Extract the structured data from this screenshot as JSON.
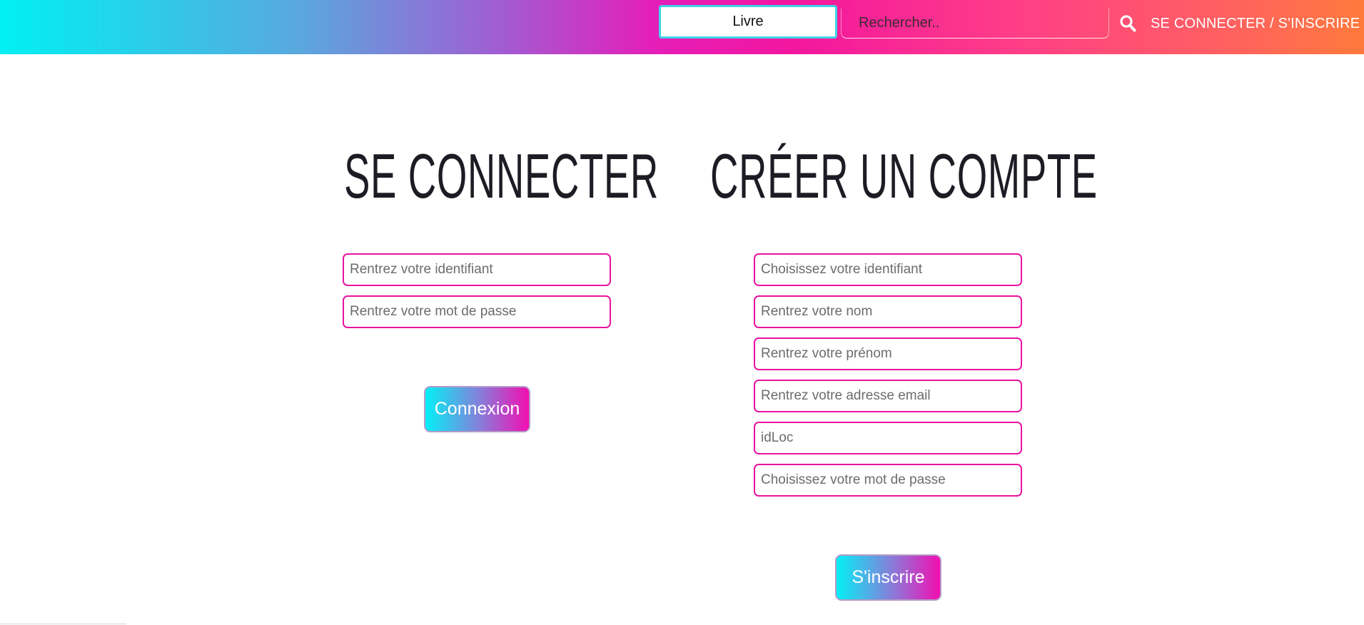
{
  "header": {
    "category": "Livre",
    "search_placeholder": "Rechercher..",
    "search_icon": "search-icon",
    "login_link": "SE CONNECTER / S'INSCRIRE"
  },
  "login": {
    "title": "SE CONNECTER",
    "fields": [
      "Rentrez votre identifiant",
      "Rentrez votre mot de passe"
    ],
    "submit": "Connexion"
  },
  "register": {
    "title": "CRÉER UN COMPTE",
    "fields": [
      "Choisissez votre identifiant",
      "Rentrez votre nom",
      "Rentrez votre prénom",
      "Rentrez votre adresse email",
      "idLoc",
      "Choisissez votre mot de passe"
    ],
    "submit": "S'inscrire"
  },
  "colors": {
    "accent": "#e8149e",
    "gradient_start": "#00f0f4",
    "gradient_mid": "#e51eb8",
    "gradient_end": "#ff7a3c"
  }
}
